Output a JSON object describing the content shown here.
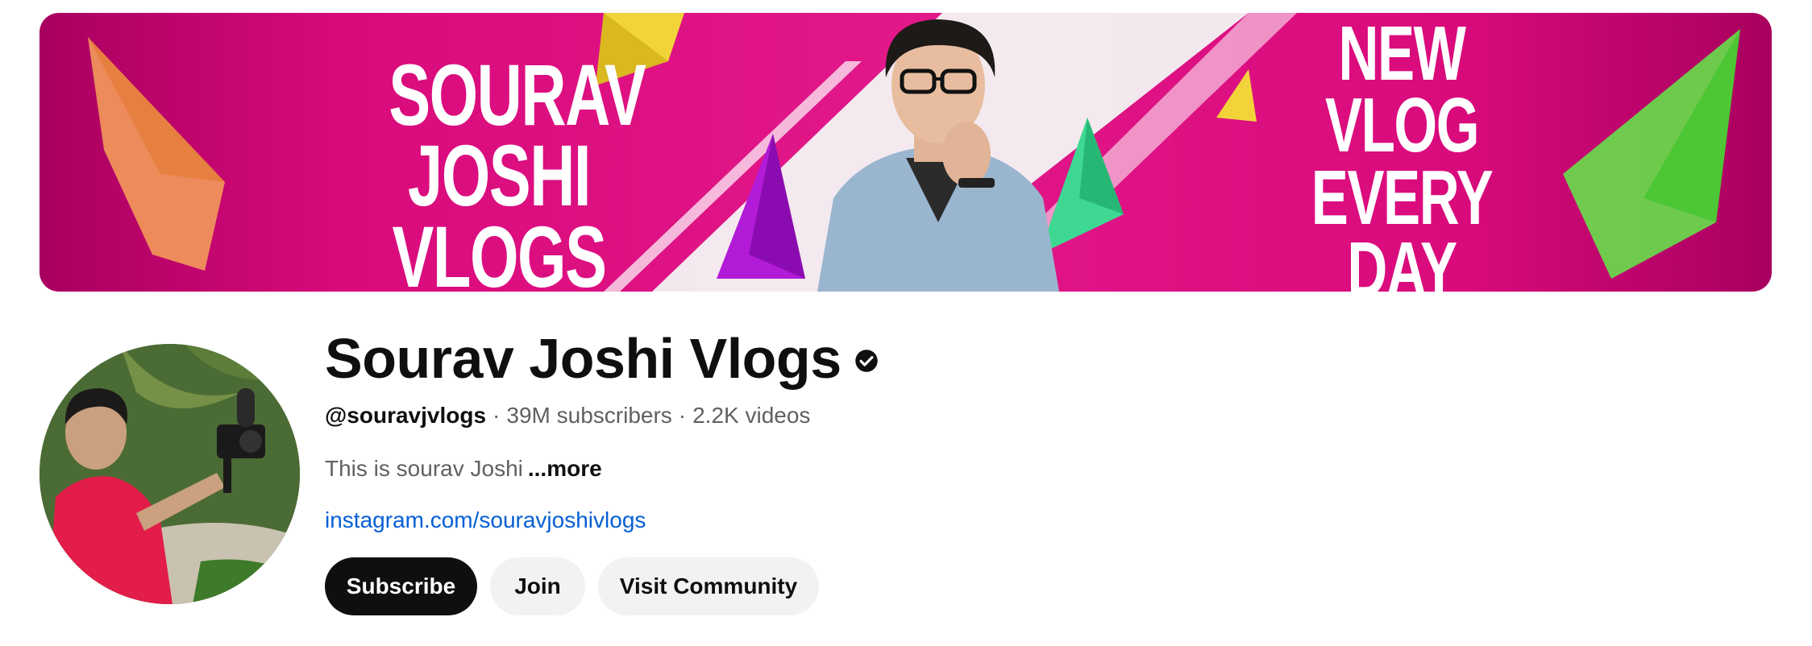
{
  "banner": {
    "left_lines": [
      "SOURAV",
      "JOSHI",
      "VLOGS"
    ],
    "right_lines": [
      "NEW",
      "VLOG",
      "EVERY",
      "DAY"
    ]
  },
  "channel": {
    "title": "Sourav Joshi Vlogs",
    "handle": "@souravjvlogs",
    "subscribers": "39M subscribers",
    "videos": "2.2K videos",
    "separator": "·",
    "description": "This is sourav Joshi",
    "more_label": "...more",
    "link": "instagram.com/souravjoshivlogs"
  },
  "buttons": {
    "subscribe": "Subscribe",
    "join": "Join",
    "community": "Visit Community"
  },
  "icons": {
    "verified": "verified-check-icon"
  },
  "colors": {
    "banner_pink": "#e2188a",
    "link_blue": "#065fd4",
    "subscribe_bg": "#0f0f0f",
    "secondary_bg": "#f2f2f2"
  }
}
